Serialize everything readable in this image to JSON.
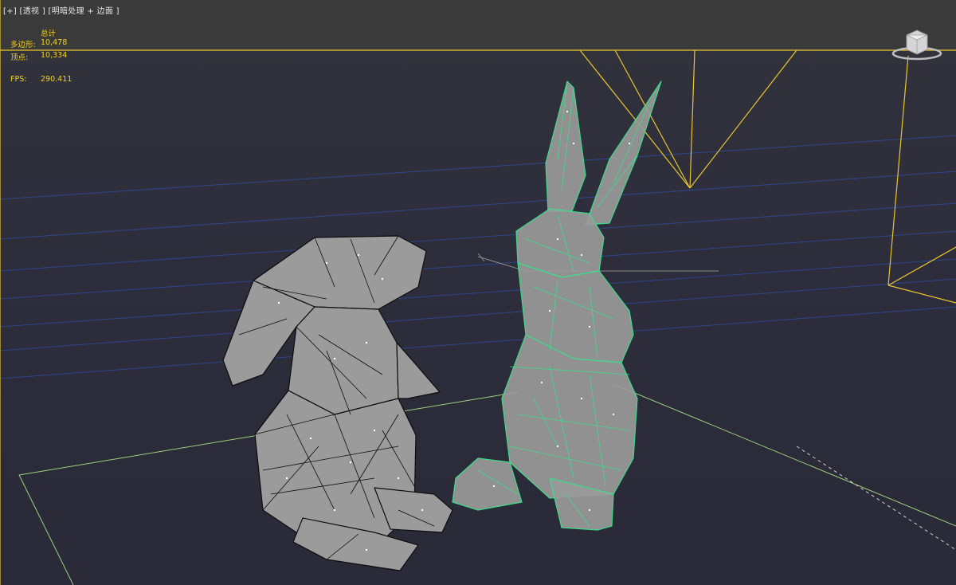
{
  "viewport": {
    "label": "[+] [透视 ] [明暗处理 + 边面 ]",
    "stats": {
      "header": "总计",
      "polygons_label": "多边形:",
      "polygons_value": "10,478",
      "vertices_label": "顶点:",
      "vertices_value": "10,334",
      "fps_label": "FPS:",
      "fps_value": "290.411"
    },
    "viewcube_icon": "viewcube-icon",
    "colors": {
      "background": "#2c2c3a",
      "top_band": "#3a3a3a",
      "stats_text": "#f2d21e",
      "camera_lines": "#e8c630",
      "selected_wire": "#3ddc8a",
      "unselected_wire": "#0d0d0d",
      "mesh_fill": "#9b9b9b",
      "grid_green": "#9bd17e",
      "blue_lines": "#2e4da0"
    }
  },
  "scene": {
    "objects": [
      {
        "name": "bunny-left",
        "selected": false
      },
      {
        "name": "bunny-right",
        "selected": true
      }
    ]
  }
}
